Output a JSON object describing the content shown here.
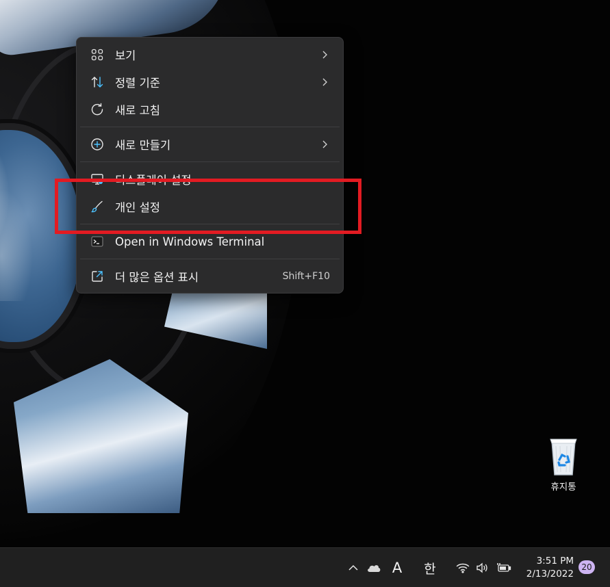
{
  "context_menu": {
    "items": [
      {
        "label": "보기",
        "icon": "grid-icon",
        "has_submenu": true
      },
      {
        "label": "정렬 기준",
        "icon": "sort-icon",
        "has_submenu": true
      },
      {
        "label": "새로 고침",
        "icon": "refresh-icon",
        "has_submenu": false
      },
      {
        "label": "새로 만들기",
        "icon": "plus-circle-icon",
        "has_submenu": true
      },
      {
        "label": "디스플레이 설정",
        "icon": "display-icon",
        "has_submenu": false
      },
      {
        "label": "개인 설정",
        "icon": "brush-icon",
        "has_submenu": false
      },
      {
        "label": "Open in Windows Terminal",
        "icon": "terminal-icon",
        "has_submenu": false
      },
      {
        "label": "더 많은 옵션 표시",
        "icon": "external-icon",
        "shortcut": "Shift+F10"
      }
    ]
  },
  "desktop": {
    "recycle_bin_label": "휴지통"
  },
  "taskbar": {
    "font_indicator": "A",
    "ime_indicator": "한",
    "time": "3:51 PM",
    "date": "2/13/2022",
    "notification_count": "20"
  },
  "colors": {
    "menu_bg": "#2b2b2c",
    "accent_blue": "#4cc2ff",
    "highlight_red": "#e21b22",
    "taskbar_bg": "#202020"
  }
}
